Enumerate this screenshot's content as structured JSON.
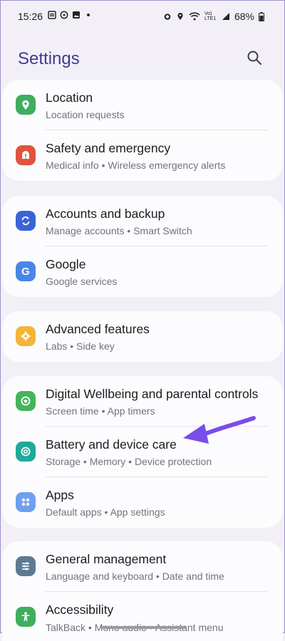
{
  "status": {
    "time": "15:26",
    "battery": "68%",
    "network": "Vo) LTE1"
  },
  "header": {
    "title": "Settings"
  },
  "items": [
    {
      "title": "Location",
      "subtitle": "Location requests",
      "icon": "location-icon",
      "color": "#3fae5e"
    },
    {
      "title": "Safety and emergency",
      "subtitle": "Medical info  •  Wireless emergency alerts",
      "icon": "alert-icon",
      "color": "#e0533f"
    },
    {
      "title": "Accounts and backup",
      "subtitle": "Manage accounts  •  Smart Switch",
      "icon": "sync-icon",
      "color": "#3a63d8"
    },
    {
      "title": "Google",
      "subtitle": "Google services",
      "icon": "google-icon",
      "color": "#4a86e8"
    },
    {
      "title": "Advanced features",
      "subtitle": "Labs  •  Side key",
      "icon": "gear-plus-icon",
      "color": "#f2b53a"
    },
    {
      "title": "Digital Wellbeing and parental controls",
      "subtitle": "Screen time  •  App timers",
      "icon": "wellbeing-icon",
      "color": "#46b45c"
    },
    {
      "title": "Battery and device care",
      "subtitle": "Storage  •  Memory  •  Device protection",
      "icon": "device-care-icon",
      "color": "#20a99a"
    },
    {
      "title": "Apps",
      "subtitle": "Default apps  •  App settings",
      "icon": "apps-icon",
      "color": "#6f9ff0"
    },
    {
      "title": "General management",
      "subtitle": "Language and keyboard  •  Date and time",
      "icon": "sliders-icon",
      "color": "#5c7a92"
    },
    {
      "title": "Accessibility",
      "subtitle": "TalkBack  •  Mono audio  •  Assistant menu",
      "icon": "accessibility-icon",
      "color": "#3fae5e"
    }
  ],
  "annotation": {
    "color": "#7b4dea"
  }
}
